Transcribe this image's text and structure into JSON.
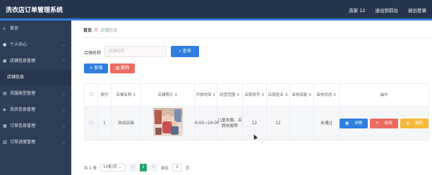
{
  "header": {
    "title": "洗衣店订单管理系统",
    "user": "店家 12",
    "back_front": "退出到前台",
    "logout": "退出登录"
  },
  "sidebar": {
    "items": [
      {
        "label": "首页",
        "icon": "home-icon",
        "chevron": false
      },
      {
        "label": "个人中心",
        "icon": "user-icon",
        "chevron": true
      },
      {
        "label": "店铺信息管理",
        "icon": "shop-icon",
        "chevron": true
      },
      {
        "label": "店铺信息",
        "icon": "",
        "chevron": false,
        "sub": true
      },
      {
        "label": "衣服类型管理",
        "icon": "shirt-icon",
        "chevron": true
      },
      {
        "label": "洗衣信息管理",
        "icon": "wash-icon",
        "chevron": true
      },
      {
        "label": "订单信息管理",
        "icon": "order-icon",
        "chevron": true
      },
      {
        "label": "订单进度管理",
        "icon": "progress-icon",
        "chevron": true
      }
    ]
  },
  "breadcrumb": {
    "home": "首页",
    "current": "店铺信息"
  },
  "search": {
    "label": "店铺名称",
    "placeholder": "店铺名称",
    "button": "查询"
  },
  "toolbar": {
    "add": "+ 新增",
    "delete": "删除"
  },
  "table": {
    "headers": [
      "",
      "索引",
      "店铺名称",
      "店铺照片",
      "开放时间",
      "经营范围",
      "店家账号",
      "店家姓名",
      "审核回复",
      "审核状态",
      "操作"
    ],
    "rows": [
      {
        "index": "1",
        "name": "测试店面",
        "photo": "shop-photo",
        "hours": "6:00~24:00",
        "scope": "儿童衣服、名牌衣服等",
        "account": "12",
        "owner": "12",
        "reply": "",
        "status": "未通过",
        "actions": [
          "详情",
          "修改",
          "删除"
        ]
      }
    ]
  },
  "pager": {
    "total": "共 1 条",
    "page_size": "10条/页",
    "prev": "<",
    "current": "1",
    "next": ">",
    "goto_label": "前往",
    "goto_value": "1",
    "goto_unit": "页"
  },
  "colors": {
    "topbar": "#25364c",
    "sidebar": "#2d3f57",
    "primary": "#2f7ee0",
    "danger": "#ec6c62",
    "warning": "#f5b93a",
    "success": "#2aa36b"
  }
}
